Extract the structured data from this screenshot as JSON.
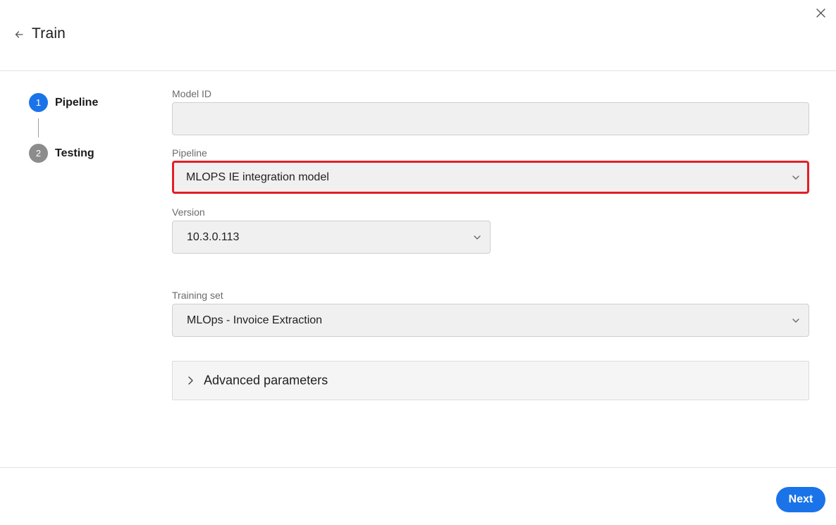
{
  "header": {
    "title": "Train",
    "back_icon": "arrow-left-icon",
    "close_icon": "close-icon"
  },
  "stepper": {
    "steps": [
      {
        "number": "1",
        "label": "Pipeline",
        "state": "active",
        "color": "#1a73e8"
      },
      {
        "number": "2",
        "label": "Testing",
        "state": "inactive",
        "color": "#8c8c8c"
      }
    ]
  },
  "form": {
    "model_id": {
      "label": "Model ID",
      "value": ""
    },
    "pipeline": {
      "label": "Pipeline",
      "value": "MLOPS IE integration model",
      "highlight_color": "#e21f26"
    },
    "version": {
      "label": "Version",
      "value": "10.3.0.113"
    },
    "training_set": {
      "label": "Training set",
      "value": "MLOps - Invoice Extraction"
    },
    "advanced": {
      "label": "Advanced parameters",
      "expanded": false
    }
  },
  "footer": {
    "next_label": "Next",
    "accent": "#1a73e8"
  }
}
